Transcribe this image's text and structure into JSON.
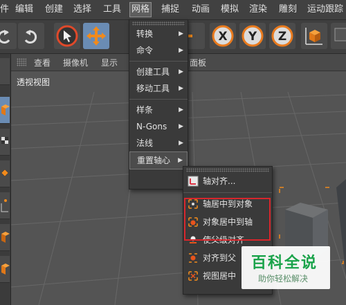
{
  "menubar": {
    "items": [
      "件",
      "编辑",
      "创建",
      "选择",
      "工具",
      "网格",
      "捕捉",
      "动画",
      "模拟",
      "渲染",
      "雕刻",
      "运动跟踪"
    ],
    "active_index": 5
  },
  "toolbar": {
    "axis_x": "X",
    "axis_y": "Y",
    "axis_z": "Z"
  },
  "viewport": {
    "menu": [
      "查看",
      "摄像机",
      "显示",
      "面板"
    ],
    "label": "透视视图"
  },
  "mesh_menu": {
    "items": [
      {
        "label": "转换",
        "has_submenu": true
      },
      {
        "label": "命令",
        "has_submenu": true
      },
      {
        "label": "创建工具",
        "has_submenu": true
      },
      {
        "label": "移动工具",
        "has_submenu": true
      },
      {
        "label": "样条",
        "has_submenu": true
      },
      {
        "label": "N-Gons",
        "has_submenu": true
      },
      {
        "label": "法线",
        "has_submenu": true
      },
      {
        "label": "重置轴心",
        "has_submenu": true,
        "highlighted": true
      }
    ]
  },
  "axis_submenu": {
    "items": [
      {
        "label": "轴对齐...",
        "icon": "axis-align-icon"
      },
      {
        "label": "轴居中到对象",
        "icon": "axis-center-icon",
        "boxed": true
      },
      {
        "label": "对象居中到轴",
        "icon": "object-center-icon",
        "boxed": true
      },
      {
        "label": "使父级对齐",
        "icon": "parent-align-icon"
      },
      {
        "label": "对齐到父",
        "icon": "align-parent-icon"
      },
      {
        "label": "视图居中",
        "icon": "view-center-icon"
      }
    ]
  },
  "watermark": {
    "title": "百科全说",
    "subtitle": "助你轻松解决"
  },
  "colors": {
    "menu_bg": "#3a3a3a",
    "highlight_box": "#d8262c",
    "selected_tool": "#6a8cb4",
    "accent_orange": "#f08a1c",
    "watermark_green": "#1aa34a"
  }
}
